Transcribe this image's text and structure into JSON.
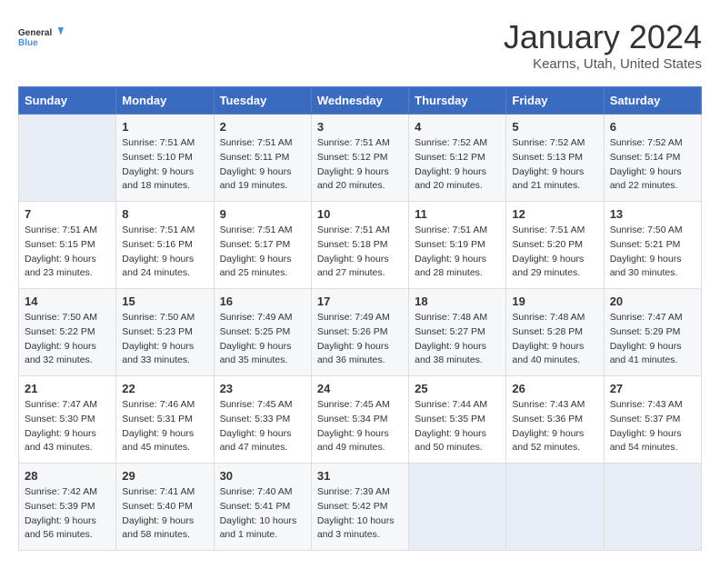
{
  "logo": {
    "line1": "General",
    "line2": "Blue"
  },
  "title": "January 2024",
  "location": "Kearns, Utah, United States",
  "days_of_week": [
    "Sunday",
    "Monday",
    "Tuesday",
    "Wednesday",
    "Thursday",
    "Friday",
    "Saturday"
  ],
  "weeks": [
    [
      {
        "day": "",
        "sunrise": "",
        "sunset": "",
        "daylight": ""
      },
      {
        "day": "1",
        "sunrise": "7:51 AM",
        "sunset": "5:10 PM",
        "daylight": "9 hours and 18 minutes."
      },
      {
        "day": "2",
        "sunrise": "7:51 AM",
        "sunset": "5:11 PM",
        "daylight": "9 hours and 19 minutes."
      },
      {
        "day": "3",
        "sunrise": "7:51 AM",
        "sunset": "5:12 PM",
        "daylight": "9 hours and 20 minutes."
      },
      {
        "day": "4",
        "sunrise": "7:52 AM",
        "sunset": "5:12 PM",
        "daylight": "9 hours and 20 minutes."
      },
      {
        "day": "5",
        "sunrise": "7:52 AM",
        "sunset": "5:13 PM",
        "daylight": "9 hours and 21 minutes."
      },
      {
        "day": "6",
        "sunrise": "7:52 AM",
        "sunset": "5:14 PM",
        "daylight": "9 hours and 22 minutes."
      }
    ],
    [
      {
        "day": "7",
        "sunrise": "7:51 AM",
        "sunset": "5:15 PM",
        "daylight": "9 hours and 23 minutes."
      },
      {
        "day": "8",
        "sunrise": "7:51 AM",
        "sunset": "5:16 PM",
        "daylight": "9 hours and 24 minutes."
      },
      {
        "day": "9",
        "sunrise": "7:51 AM",
        "sunset": "5:17 PM",
        "daylight": "9 hours and 25 minutes."
      },
      {
        "day": "10",
        "sunrise": "7:51 AM",
        "sunset": "5:18 PM",
        "daylight": "9 hours and 27 minutes."
      },
      {
        "day": "11",
        "sunrise": "7:51 AM",
        "sunset": "5:19 PM",
        "daylight": "9 hours and 28 minutes."
      },
      {
        "day": "12",
        "sunrise": "7:51 AM",
        "sunset": "5:20 PM",
        "daylight": "9 hours and 29 minutes."
      },
      {
        "day": "13",
        "sunrise": "7:50 AM",
        "sunset": "5:21 PM",
        "daylight": "9 hours and 30 minutes."
      }
    ],
    [
      {
        "day": "14",
        "sunrise": "7:50 AM",
        "sunset": "5:22 PM",
        "daylight": "9 hours and 32 minutes."
      },
      {
        "day": "15",
        "sunrise": "7:50 AM",
        "sunset": "5:23 PM",
        "daylight": "9 hours and 33 minutes."
      },
      {
        "day": "16",
        "sunrise": "7:49 AM",
        "sunset": "5:25 PM",
        "daylight": "9 hours and 35 minutes."
      },
      {
        "day": "17",
        "sunrise": "7:49 AM",
        "sunset": "5:26 PM",
        "daylight": "9 hours and 36 minutes."
      },
      {
        "day": "18",
        "sunrise": "7:48 AM",
        "sunset": "5:27 PM",
        "daylight": "9 hours and 38 minutes."
      },
      {
        "day": "19",
        "sunrise": "7:48 AM",
        "sunset": "5:28 PM",
        "daylight": "9 hours and 40 minutes."
      },
      {
        "day": "20",
        "sunrise": "7:47 AM",
        "sunset": "5:29 PM",
        "daylight": "9 hours and 41 minutes."
      }
    ],
    [
      {
        "day": "21",
        "sunrise": "7:47 AM",
        "sunset": "5:30 PM",
        "daylight": "9 hours and 43 minutes."
      },
      {
        "day": "22",
        "sunrise": "7:46 AM",
        "sunset": "5:31 PM",
        "daylight": "9 hours and 45 minutes."
      },
      {
        "day": "23",
        "sunrise": "7:45 AM",
        "sunset": "5:33 PM",
        "daylight": "9 hours and 47 minutes."
      },
      {
        "day": "24",
        "sunrise": "7:45 AM",
        "sunset": "5:34 PM",
        "daylight": "9 hours and 49 minutes."
      },
      {
        "day": "25",
        "sunrise": "7:44 AM",
        "sunset": "5:35 PM",
        "daylight": "9 hours and 50 minutes."
      },
      {
        "day": "26",
        "sunrise": "7:43 AM",
        "sunset": "5:36 PM",
        "daylight": "9 hours and 52 minutes."
      },
      {
        "day": "27",
        "sunrise": "7:43 AM",
        "sunset": "5:37 PM",
        "daylight": "9 hours and 54 minutes."
      }
    ],
    [
      {
        "day": "28",
        "sunrise": "7:42 AM",
        "sunset": "5:39 PM",
        "daylight": "9 hours and 56 minutes."
      },
      {
        "day": "29",
        "sunrise": "7:41 AM",
        "sunset": "5:40 PM",
        "daylight": "9 hours and 58 minutes."
      },
      {
        "day": "30",
        "sunrise": "7:40 AM",
        "sunset": "5:41 PM",
        "daylight": "10 hours and 1 minute."
      },
      {
        "day": "31",
        "sunrise": "7:39 AM",
        "sunset": "5:42 PM",
        "daylight": "10 hours and 3 minutes."
      },
      {
        "day": "",
        "sunrise": "",
        "sunset": "",
        "daylight": ""
      },
      {
        "day": "",
        "sunrise": "",
        "sunset": "",
        "daylight": ""
      },
      {
        "day": "",
        "sunrise": "",
        "sunset": "",
        "daylight": ""
      }
    ]
  ],
  "labels": {
    "sunrise": "Sunrise:",
    "sunset": "Sunset:",
    "daylight": "Daylight:"
  }
}
